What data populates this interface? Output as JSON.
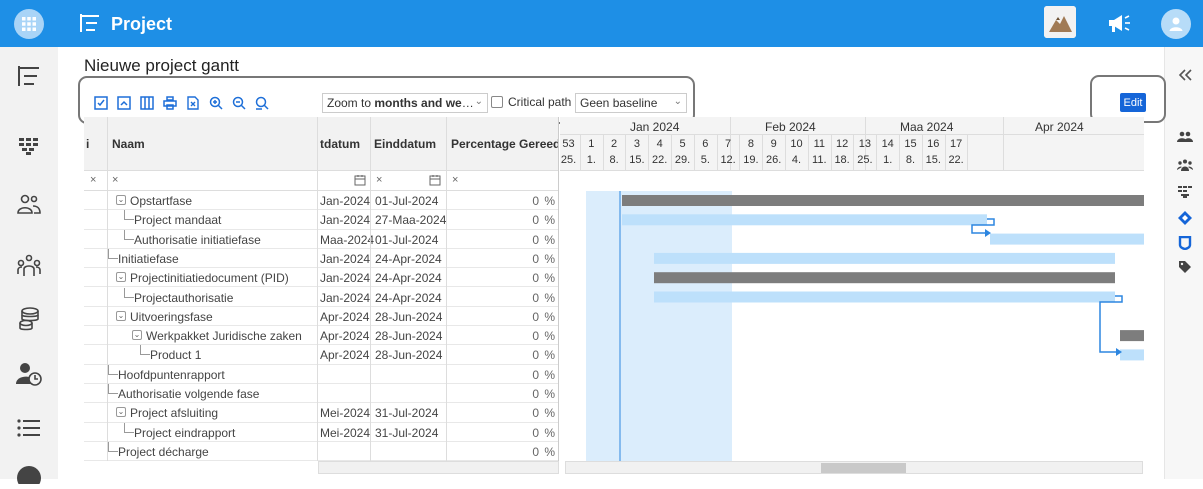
{
  "app": {
    "title": "Project"
  },
  "page": {
    "title": "Nieuwe project gantt"
  },
  "toolbar": {
    "icons": [
      "check-square-icon",
      "collapse-icon",
      "columns-icon",
      "print-icon",
      "export-icon",
      "zoom-in-icon",
      "zoom-out-icon",
      "zoom-fit-icon"
    ],
    "zoom_prefix": "Zoom to ",
    "zoom_bold": "months and we",
    "zoom_suffix": "…",
    "critical_path_label": "Critical path",
    "baseline_value": "Geen baseline",
    "edit_label": "Edit"
  },
  "grid": {
    "columns": {
      "index": "i",
      "name": "Naam",
      "start": "tdatum",
      "end": "Einddatum",
      "percent": "Percentage Gereed"
    },
    "filter": {
      "clear": "×"
    },
    "percent_symbol": "%",
    "rows": [
      {
        "name": "Opstartfase",
        "start": "Jan-2024",
        "end": "01-Jul-2024",
        "percent": "0",
        "level": 0,
        "expand": true
      },
      {
        "name": "Project mandaat",
        "start": "Jan-2024",
        "end": "27-Maa-2024",
        "percent": "0",
        "level": 1,
        "expand": false
      },
      {
        "name": "Authorisatie initiatiefase",
        "start": "Maa-2024",
        "end": "01-Jul-2024",
        "percent": "0",
        "level": 1,
        "expand": false
      },
      {
        "name": "Initiatiefase",
        "start": "Jan-2024",
        "end": "24-Apr-2024",
        "percent": "0",
        "level": 0,
        "expand": false
      },
      {
        "name": "Projectinitiatiedocument (PID)",
        "start": "Jan-2024",
        "end": "24-Apr-2024",
        "percent": "0",
        "level": 0,
        "expand": true
      },
      {
        "name": "Projectauthorisatie",
        "start": "Jan-2024",
        "end": "24-Apr-2024",
        "percent": "0",
        "level": 1,
        "expand": false
      },
      {
        "name": "Uitvoeringsfase",
        "start": "Apr-2024",
        "end": "28-Jun-2024",
        "percent": "0",
        "level": 0,
        "expand": true
      },
      {
        "name": "Werkpakket Juridische zaken",
        "start": "Apr-2024",
        "end": "28-Jun-2024",
        "percent": "0",
        "level": 1,
        "expand": true
      },
      {
        "name": "Product 1",
        "start": "Apr-2024",
        "end": "28-Jun-2024",
        "percent": "0",
        "level": 2,
        "expand": false
      },
      {
        "name": "Hoofdpuntenrapport",
        "start": "",
        "end": "",
        "percent": "0",
        "level": 0,
        "expand": false
      },
      {
        "name": "Authorisatie volgende fase",
        "start": "",
        "end": "",
        "percent": "0",
        "level": 0,
        "expand": false
      },
      {
        "name": "Project afsluiting",
        "start": "Mei-2024",
        "end": "31-Jul-2024",
        "percent": "0",
        "level": 0,
        "expand": true
      },
      {
        "name": "Project eindrapport",
        "start": "Mei-2024",
        "end": "31-Jul-2024",
        "percent": "0",
        "level": 1,
        "expand": false
      },
      {
        "name": "Project décharge",
        "start": "",
        "end": "",
        "percent": "0",
        "level": 0,
        "expand": false
      }
    ]
  },
  "timeline": {
    "months": [
      "Jan 2024",
      "Feb 2024",
      "Maa 2024",
      "Apr 2024"
    ],
    "weeks": [
      "53",
      "1",
      "2",
      "3",
      "4",
      "5",
      "6",
      "7",
      "8",
      "9",
      "10",
      "11",
      "12",
      "13",
      "14",
      "15",
      "16",
      "17"
    ],
    "days": [
      "25.",
      "1.",
      "8.",
      "15.",
      "22.",
      "29.",
      "5.",
      "12.",
      "19.",
      "26.",
      "4.",
      "11.",
      "18.",
      "25.",
      "1.",
      "8.",
      "15.",
      "22."
    ]
  },
  "colors": {
    "topbar": "#1e8fe6",
    "summary_bar": "#7d7d7d",
    "task_bar": "#bde0fb",
    "link": "#2d86e0",
    "edit_button": "#1565d8"
  }
}
